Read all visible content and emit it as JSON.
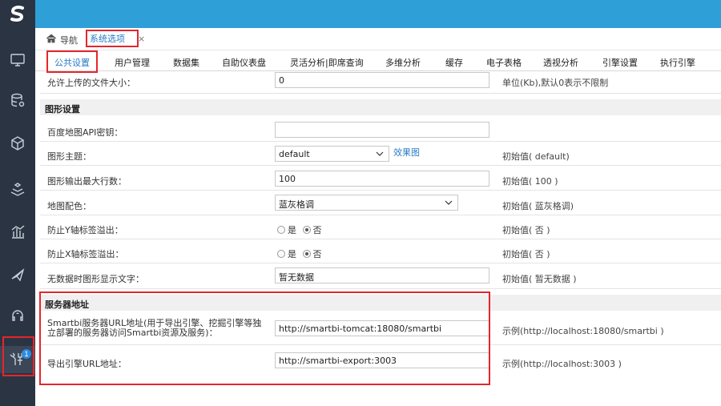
{
  "nav": {
    "home_label": "导航",
    "open_tab_label": "系统选项",
    "close_symbol": "×"
  },
  "sidebar": {
    "logo": "S",
    "items": [
      {
        "icon": "monitor-icon"
      },
      {
        "icon": "database-icon"
      },
      {
        "icon": "cube-icon"
      },
      {
        "icon": "layers-icon"
      },
      {
        "icon": "bar-chart-icon"
      },
      {
        "icon": "send-icon"
      },
      {
        "icon": "headset-icon"
      },
      {
        "icon": "tools-icon",
        "badge": "1"
      }
    ]
  },
  "tabs": [
    "公共设置",
    "用户管理",
    "数据集",
    "自助仪表盘",
    "灵活分析|即席查询",
    "多维分析",
    "缓存",
    "电子表格",
    "透视分析",
    "引擎设置",
    "执行引擎"
  ],
  "rows": {
    "upload": {
      "label": "允许上传的文件大小：",
      "value": "0",
      "hint": "单位(Kb),默认0表示不限制"
    },
    "graph_section": "图形设置",
    "baidu": {
      "label": "百度地图API密钥：",
      "value": ""
    },
    "theme": {
      "label": "图形主题：",
      "value": "default",
      "link": "效果图",
      "hint": "初始值( default)"
    },
    "maxrows": {
      "label": "图形输出最大行数：",
      "value": "100",
      "hint": "初始值( 100 )"
    },
    "mapcolor": {
      "label": "地图配色：",
      "value": "蓝灰格调",
      "hint": "初始值( 蓝灰格调)"
    },
    "yoverflow": {
      "label": "防止Y轴标签溢出：",
      "yes": "是",
      "no": "否",
      "hint": "初始值( 否 )"
    },
    "xoverflow": {
      "label": "防止X轴标签溢出：",
      "yes": "是",
      "no": "否",
      "hint": "初始值( 否 )"
    },
    "nodata": {
      "label": "无数据时图形显示文字：",
      "value": "暂无数据",
      "hint": "初始值( 暂无数据 )"
    },
    "server_section": "服务器地址",
    "smartbi_url": {
      "label_line1": "Smartbi服务器URL地址(用于导出引擎、挖掘引擎等独",
      "label_line2": "立部署的服务器访问Smartbi资源及服务)：",
      "value": "http://smartbi-tomcat:18080/smartbi",
      "hint": "示例(http://localhost:18080/smartbi )"
    },
    "export_url": {
      "label": "导出引擎URL地址：",
      "value": "http://smartbi-export:3003",
      "hint": "示例(http://localhost:3003 )"
    }
  },
  "colors": {
    "topbar": "#2f9fd8",
    "sidebar": "#2b3442",
    "highlight": "#e5262c",
    "accent": "#2a7cc7"
  }
}
